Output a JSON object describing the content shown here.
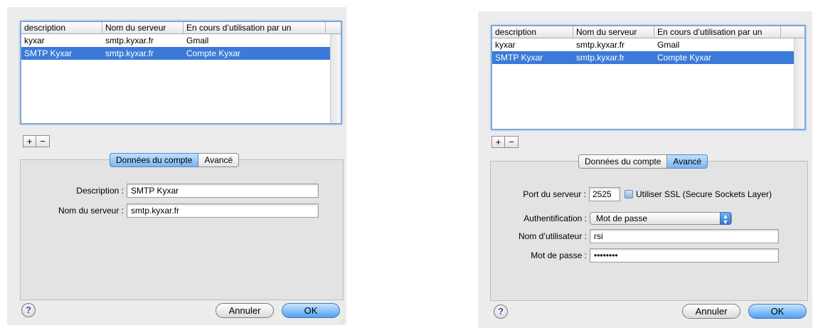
{
  "table": {
    "headers": [
      "description",
      "Nom du serveur",
      "En cours d’utilisation par un"
    ],
    "rows": [
      [
        "kyxar",
        "smtp.kyxar.fr",
        "Gmail"
      ],
      [
        "SMTP Kyxar",
        "smtp.kyxar.fr",
        "Compte Kyxar"
      ]
    ]
  },
  "buttons": {
    "add": "+",
    "remove": "−",
    "help": "?",
    "cancel": "Annuler",
    "ok": "OK"
  },
  "tabs": {
    "account": "Données du compte",
    "advanced": "Avancé"
  },
  "left": {
    "description_label": "Description :",
    "description_value": "SMTP Kyxar",
    "server_label": "Nom du serveur :",
    "server_value": "smtp.kyxar.fr"
  },
  "right": {
    "port_label": "Port du serveur :",
    "port_value": "2525",
    "ssl_label": "Utiliser SSL (Secure Sockets Layer)",
    "auth_label": "Authentification :",
    "auth_value": "Mot de passe",
    "user_label": "Nom d’utilisateur :",
    "user_value": "rsi",
    "password_label": "Mot de passe :",
    "password_value": "••••••••"
  },
  "colors": {
    "selection": "#3b7ad8",
    "focus_ring": "#7ea7d8",
    "default_button": "#4fa0ef"
  }
}
